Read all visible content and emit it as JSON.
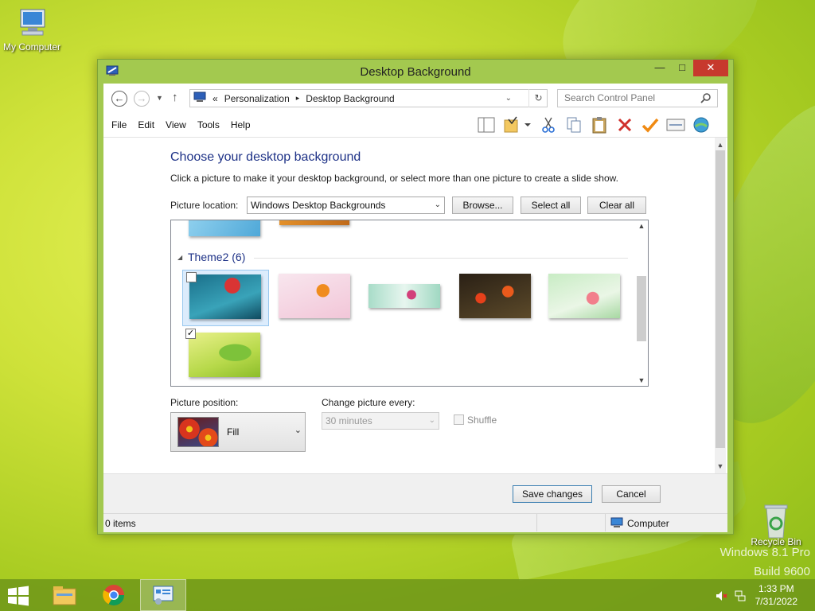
{
  "desktop": {
    "icons": [
      {
        "label": "My Computer"
      },
      {
        "label": "Recycle Bin"
      }
    ],
    "watermark_line1": "Windows 8.1 Pro",
    "watermark_line2": "Build 9600"
  },
  "window": {
    "title": "Desktop Background",
    "controls": {
      "minimize": "—",
      "maximize": "□",
      "close": "✕"
    }
  },
  "address": {
    "chevron": "«",
    "breadcrumb": [
      "Personalization",
      "Desktop Background"
    ],
    "separator": "▸",
    "search_placeholder": "Search Control Panel"
  },
  "menu": [
    "File",
    "Edit",
    "View",
    "Tools",
    "Help"
  ],
  "toolbar_icons": [
    "layout-icon",
    "folder-check-icon",
    "cut-icon",
    "copy-icon",
    "paste-icon",
    "delete-icon",
    "checkmark-icon",
    "properties-icon",
    "globe-icon"
  ],
  "content": {
    "heading": "Choose your desktop background",
    "description": "Click a picture to make it your desktop background, or select more than one picture to create a slide show.",
    "picture_location_label": "Picture location:",
    "picture_location_value": "Windows Desktop Backgrounds",
    "browse_label": "Browse...",
    "select_all_label": "Select all",
    "clear_all_label": "Clear all",
    "group_title": "Theme2 (6)",
    "thumbnails": [
      {
        "subject": "red flower on teal",
        "checked": false,
        "selected": true
      },
      {
        "subject": "orange flower on pink",
        "checked": false,
        "selected": false
      },
      {
        "subject": "pink flower on mint",
        "checked": false,
        "selected": false
      },
      {
        "subject": "red tulips on dark",
        "checked": false,
        "selected": false
      },
      {
        "subject": "pink lily on green",
        "checked": false,
        "selected": false
      },
      {
        "subject": "green leaf",
        "checked": true,
        "selected": false
      }
    ],
    "picture_position_label": "Picture position:",
    "picture_position_value": "Fill",
    "change_picture_label": "Change picture every:",
    "change_picture_value": "30 minutes",
    "shuffle_label": "Shuffle",
    "shuffle_checked": false
  },
  "footer": {
    "save_label": "Save changes",
    "cancel_label": "Cancel"
  },
  "statusbar": {
    "items": "0 items",
    "location": "Computer"
  },
  "taskbar": {
    "time": "1:33 PM",
    "date": "7/31/2022"
  },
  "colors": {
    "accent_title": "#1e3287",
    "window_frame": "#a3c94f",
    "close_button": "#c7392d"
  }
}
